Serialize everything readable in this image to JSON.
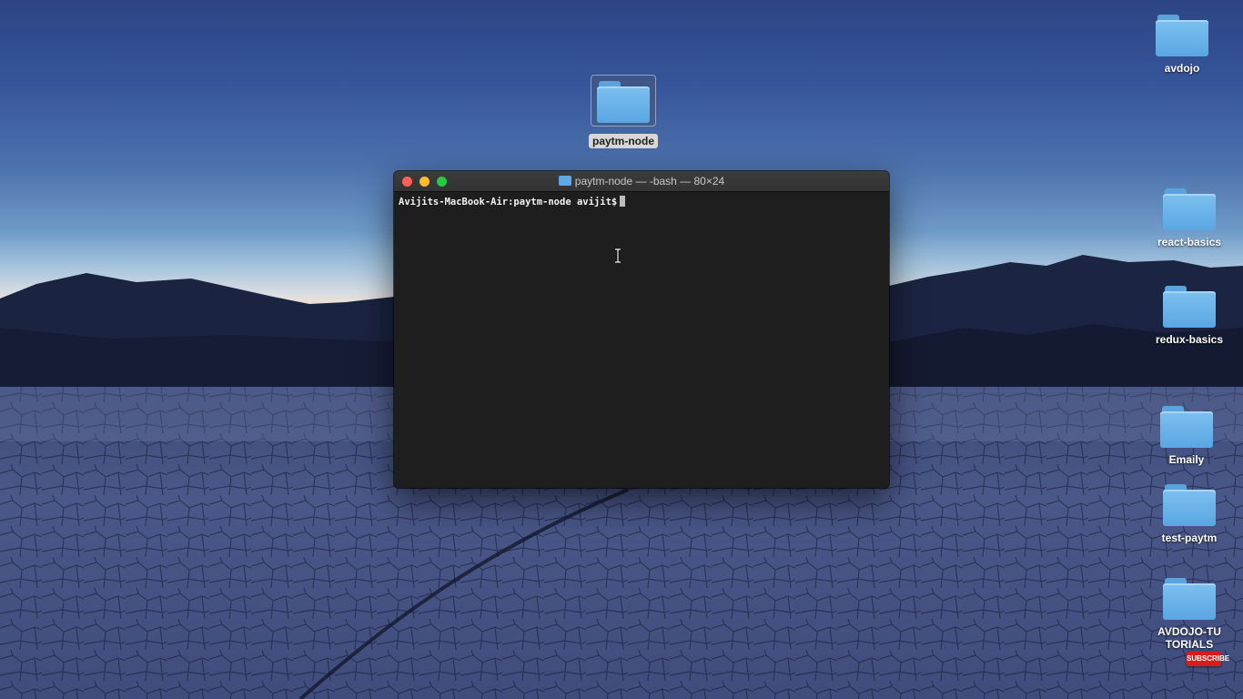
{
  "desktop": {
    "selected_folder": "paytm-node",
    "folders": [
      {
        "label": "avdojo"
      },
      {
        "label": "react-basics"
      },
      {
        "label": "redux-basics"
      },
      {
        "label": "Emaily"
      },
      {
        "label": "test-paytm"
      },
      {
        "label": "AVDOJO-TUTORIALS"
      }
    ]
  },
  "terminal": {
    "title": "paytm-node — -bash — 80×24",
    "prompt": "Avijits-MacBook-Air:paytm-node avijit$"
  },
  "overlay": {
    "subscribe_label": "SUBSCRIBE"
  },
  "colors": {
    "close": "#fe5f57",
    "minimize": "#febc2e",
    "zoom": "#28c840",
    "folder": "#6ab4ec",
    "terminal_bg": "#1e1e1e",
    "subscribe_bg": "#d81b1b"
  },
  "icons": [
    "folder-icon",
    "ibeam-cursor-icon"
  ]
}
